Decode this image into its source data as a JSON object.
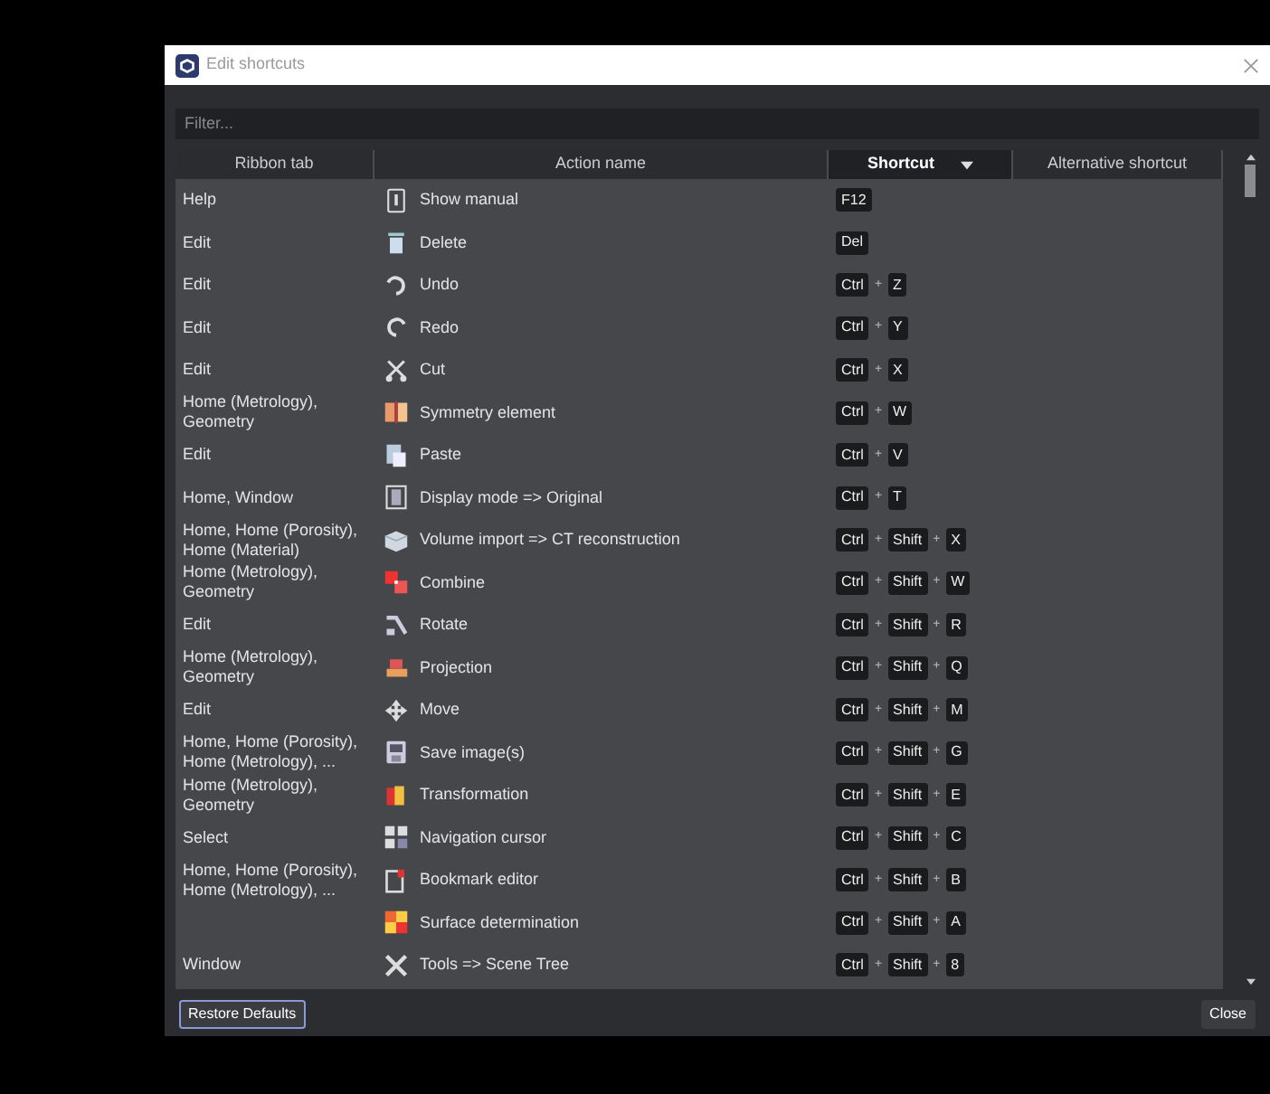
{
  "window": {
    "title": "Edit shortcuts"
  },
  "filter": {
    "placeholder": "Filter..."
  },
  "table": {
    "columns": [
      {
        "label": "Ribbon tab",
        "sorted": false
      },
      {
        "label": "Action name",
        "sorted": false
      },
      {
        "label": "Shortcut",
        "sorted": true
      },
      {
        "label": "Alternative shortcut",
        "sorted": false
      }
    ],
    "key_separator": "+",
    "rows": [
      {
        "ribbon_tab": "Help",
        "action": "Show manual",
        "shortcut": [
          "F12"
        ]
      },
      {
        "ribbon_tab": "Edit",
        "action": "Delete",
        "shortcut": [
          "Del"
        ]
      },
      {
        "ribbon_tab": "Edit",
        "action": "Undo",
        "shortcut": [
          "Ctrl",
          "Z"
        ]
      },
      {
        "ribbon_tab": "Edit",
        "action": "Redo",
        "shortcut": [
          "Ctrl",
          "Y"
        ]
      },
      {
        "ribbon_tab": "Edit",
        "action": "Cut",
        "shortcut": [
          "Ctrl",
          "X"
        ]
      },
      {
        "ribbon_tab": "Home (Metrology), Geometry",
        "action": "Symmetry element",
        "shortcut": [
          "Ctrl",
          "W"
        ]
      },
      {
        "ribbon_tab": "Edit",
        "action": "Paste",
        "shortcut": [
          "Ctrl",
          "V"
        ]
      },
      {
        "ribbon_tab": "Home, Window",
        "action": "Display mode => Original",
        "shortcut": [
          "Ctrl",
          "T"
        ]
      },
      {
        "ribbon_tab": "Home, Home (Porosity), Home (Material)",
        "action": "Volume import => CT reconstruction",
        "shortcut": [
          "Ctrl",
          "Shift",
          "X"
        ]
      },
      {
        "ribbon_tab": "Home (Metrology), Geometry",
        "action": "Combine",
        "shortcut": [
          "Ctrl",
          "Shift",
          "W"
        ]
      },
      {
        "ribbon_tab": "Edit",
        "action": "Rotate",
        "shortcut": [
          "Ctrl",
          "Shift",
          "R"
        ]
      },
      {
        "ribbon_tab": "Home (Metrology), Geometry",
        "action": "Projection",
        "shortcut": [
          "Ctrl",
          "Shift",
          "Q"
        ]
      },
      {
        "ribbon_tab": "Edit",
        "action": "Move",
        "shortcut": [
          "Ctrl",
          "Shift",
          "M"
        ]
      },
      {
        "ribbon_tab": "Home, Home (Porosity), Home (Metrology), ...",
        "action": "Save image(s)",
        "shortcut": [
          "Ctrl",
          "Shift",
          "G"
        ]
      },
      {
        "ribbon_tab": "Home (Metrology), Geometry",
        "action": "Transformation",
        "shortcut": [
          "Ctrl",
          "Shift",
          "E"
        ]
      },
      {
        "ribbon_tab": "Select",
        "action": "Navigation cursor",
        "shortcut": [
          "Ctrl",
          "Shift",
          "C"
        ]
      },
      {
        "ribbon_tab": "Home, Home (Porosity), Home (Metrology), ...",
        "action": "Bookmark editor",
        "shortcut": [
          "Ctrl",
          "Shift",
          "B"
        ]
      },
      {
        "action": "Surface determination",
        "shortcut": [
          "Ctrl",
          "Shift",
          "A"
        ]
      },
      {
        "ribbon_tab": "Window",
        "action": "Tools => Scene Tree",
        "shortcut": [
          "Ctrl",
          "Shift",
          "8"
        ]
      }
    ]
  },
  "buttons": {
    "restore": "Restore Defaults",
    "close": "Close"
  }
}
